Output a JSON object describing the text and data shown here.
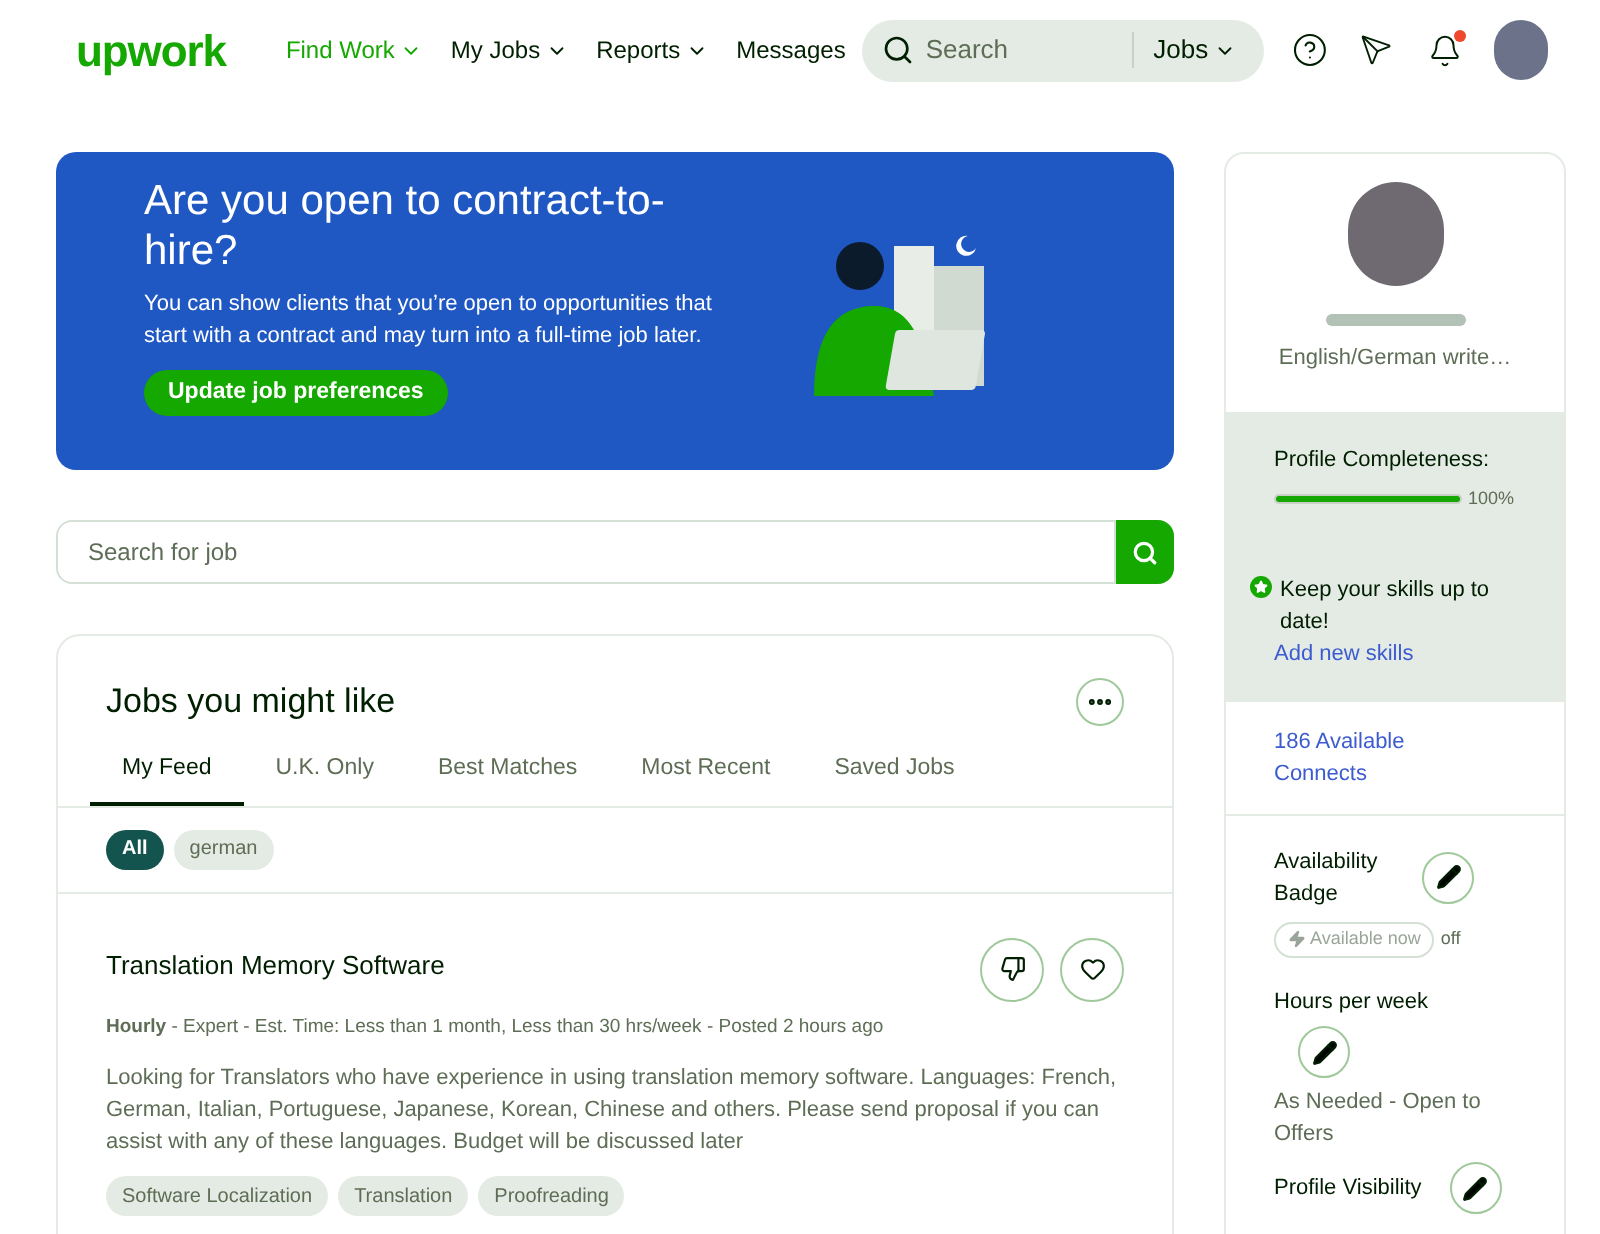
{
  "header": {
    "logo": "upwork",
    "nav": [
      {
        "label": "Find Work",
        "selected": true,
        "dropdown": true
      },
      {
        "label": "My Jobs",
        "selected": false,
        "dropdown": true
      },
      {
        "label": "Reports",
        "selected": false,
        "dropdown": true
      },
      {
        "label": "Messages",
        "selected": false,
        "dropdown": false
      }
    ],
    "search": {
      "placeholder": "Search",
      "scope": "Jobs"
    },
    "notifications": {
      "unread": true
    }
  },
  "banner": {
    "title": "Are you open to contract-to-hire?",
    "text": "You can show clients that you’re open to opportunities that start with a contract and may turn into a full-time job later.",
    "button": "Update job preferences"
  },
  "job_search": {
    "placeholder": "Search for job"
  },
  "feed": {
    "title": "Jobs you might like",
    "tabs": [
      {
        "label": "My Feed",
        "selected": true
      },
      {
        "label": "U.K. Only",
        "selected": false
      },
      {
        "label": "Best Matches",
        "selected": false
      },
      {
        "label": "Most Recent",
        "selected": false
      },
      {
        "label": "Saved Jobs",
        "selected": false
      }
    ],
    "filters": [
      {
        "label": "All",
        "selected": true
      },
      {
        "label": "german",
        "selected": false
      }
    ],
    "jobs": [
      {
        "title": "Translation Memory Software",
        "type": "Hourly",
        "meta": " - Expert - Est. Time: Less than 1 month, Less than 30 hrs/week - Posted 2 hours ago",
        "description": "Looking for Translators who have experience in using translation memory software. Languages: French, German, Italian, Portuguese, Japanese, Korean, Chinese and others. Please send proposal if you can assist with any of these languages. Budget will be discussed later",
        "skills": [
          "Software Localization",
          "Translation",
          "Proofreading"
        ]
      }
    ]
  },
  "sidebar": {
    "headline": "English/German write…",
    "completeness": {
      "label": "Profile Completeness:",
      "level": 1,
      "reading": "100%"
    },
    "tip": {
      "text": "Keep your skills up to date!",
      "link": "Add new skills"
    },
    "connects": "186 Available Connects",
    "availability": {
      "label": "Availability Badge",
      "badge": "Available now",
      "on": false,
      "state": "off"
    },
    "hours": {
      "label": "Hours per week",
      "value": "As Needed - Open to Offers"
    },
    "visibility": {
      "label": "Profile Visibility"
    }
  }
}
